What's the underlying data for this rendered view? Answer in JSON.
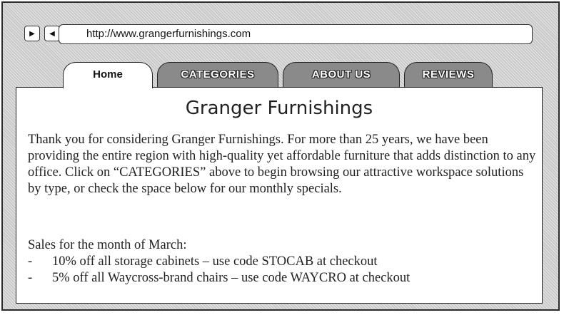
{
  "browser": {
    "url": "http://www.grangerfurnishings.com",
    "forward_icon": "triangle-right",
    "back_icon": "triangle-left"
  },
  "tabs": [
    {
      "label": "Home",
      "active": true
    },
    {
      "label": "CATEGORIES",
      "active": false
    },
    {
      "label": "ABOUT US",
      "active": false
    },
    {
      "label": "REVIEWS",
      "active": false
    }
  ],
  "page": {
    "title": "Granger Furnishings",
    "intro": "Thank you for considering Granger Furnishings. For more than 25 years, we have been providing the entire region with high-quality yet affordable furniture that adds distinction to any office. Click on “CATEGORIES” above to begin browsing our attractive workspace solutions by type, or check the space below for our monthly specials.",
    "sales_heading": "Sales for the month of March:",
    "sales": [
      {
        "dash": "-",
        "text": "10% off all storage cabinets – use code STOCAB at checkout"
      },
      {
        "dash": "-",
        "text": "5% off all Waycross-brand chairs – use code WAYCRO at checkout"
      }
    ]
  },
  "colors": {
    "inactive_tab": "#8a8a8a",
    "frame_hatch": "#c9c9c9"
  }
}
